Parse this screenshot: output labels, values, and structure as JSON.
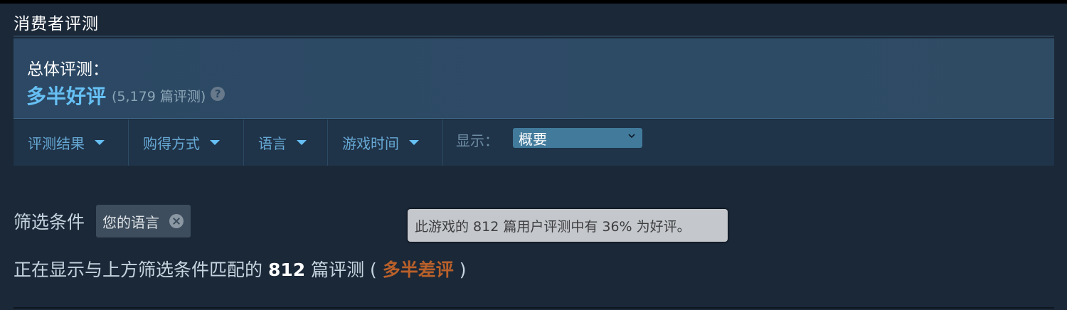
{
  "section": {
    "title": "消费者评测"
  },
  "summary": {
    "label": "总体评测：",
    "rating": "多半好评",
    "count": "(5,179 篇评测)",
    "help_glyph": "?"
  },
  "filters_bar": {
    "items": [
      {
        "label": "评测结果"
      },
      {
        "label": "购得方式"
      },
      {
        "label": "语言"
      },
      {
        "label": "游戏时间"
      }
    ],
    "display_label": "显示：",
    "display_value": "概要"
  },
  "active_filters": {
    "label": "筛选条件",
    "chip": "您的语言"
  },
  "tooltip": {
    "text": "此游戏的 812 篇用户评测中有 36% 为好评。"
  },
  "result": {
    "prefix": "正在显示与上方筛选条件匹配的",
    "count": "812",
    "suffix": "篇评测 (",
    "rating": "多半差评",
    "close": ")"
  },
  "colors": {
    "positive": "#66c0f4",
    "negative": "#b9602a",
    "background": "#1b2838",
    "panel": "#2c4864"
  },
  "icons": {
    "help": "help-icon",
    "dropdown": "caret-down-icon",
    "remove": "close-icon",
    "select": "chevron-down-icon"
  }
}
